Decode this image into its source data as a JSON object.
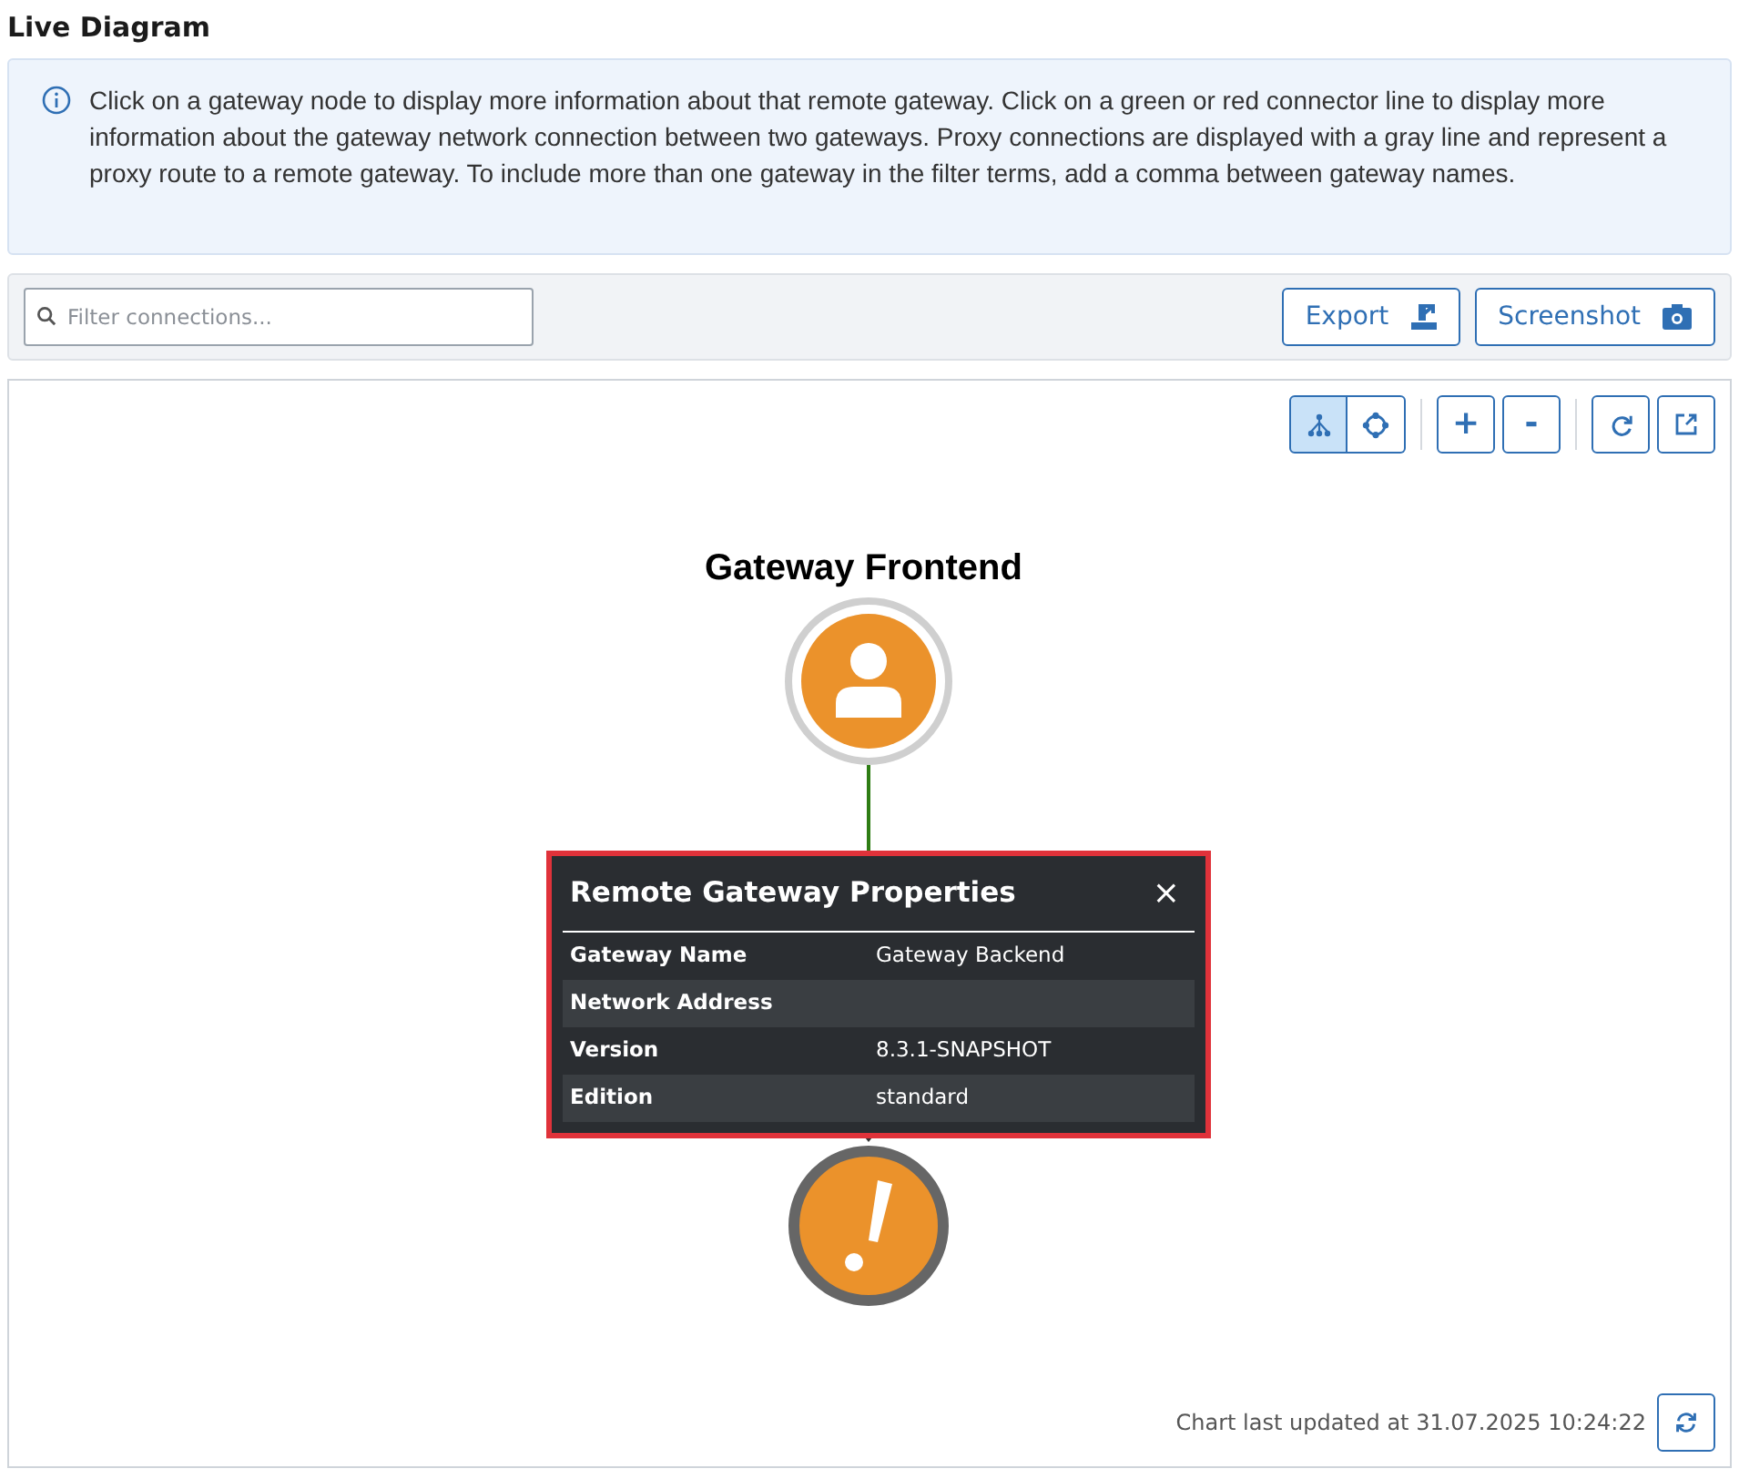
{
  "title": "Live Diagram",
  "info": "Click on a gateway node to display more information about that remote gateway. Click on a green or red connector line to display more information about the gateway network connection between two gateways. Proxy connections are displayed with a gray line and represent a proxy route to a remote gateway. To include more than one gateway in the filter terms, add a comma between gateway names.",
  "filter": {
    "placeholder": "Filter connections..."
  },
  "buttons": [
    {
      "label": "Export",
      "kind": "export"
    },
    {
      "label": "Screenshot",
      "kind": "camera"
    }
  ],
  "view_modes": [
    {
      "kind": "tree",
      "selected": true
    },
    {
      "kind": "radial",
      "selected": false
    }
  ],
  "zoom_buttons": [
    "+",
    "-"
  ],
  "nodes": [
    {
      "label": "Gateway Frontend",
      "kind": "local"
    },
    {
      "kind": "warning"
    }
  ],
  "popup": {
    "title": "Remote Gateway Properties",
    "close": "×",
    "rows": [
      {
        "name": "Gateway Name",
        "value": "Gateway Backend"
      },
      {
        "name": "Network Address"
      },
      {
        "name": "Version",
        "value": "8.3.1-SNAPSHOT"
      },
      {
        "name": "Edition",
        "value": "standard"
      }
    ]
  },
  "footer": "Chart last updated at 31.07.2025 10:24:22"
}
